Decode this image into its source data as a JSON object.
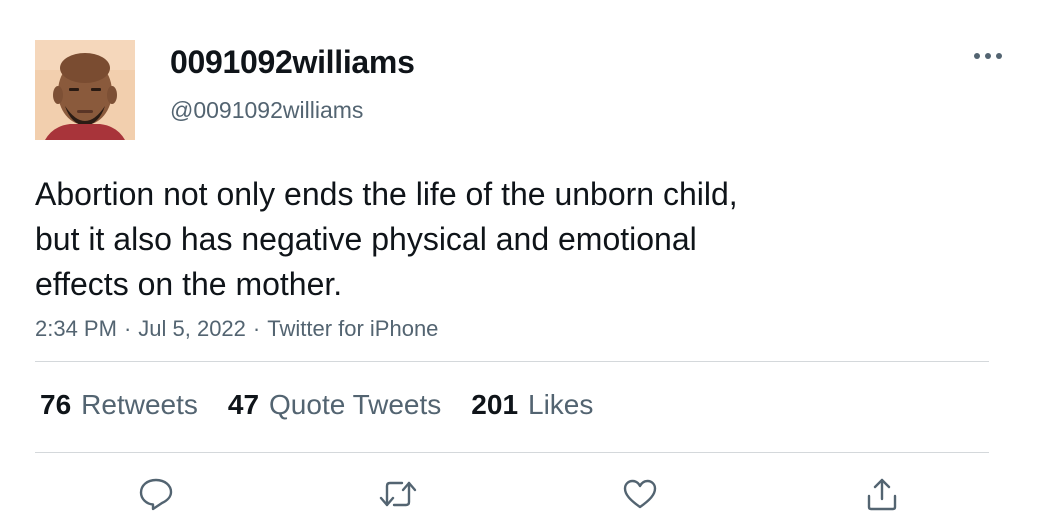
{
  "tweet": {
    "author": {
      "display_name": "0091092williams",
      "handle": "@0091092williams"
    },
    "text_lines": [
      "Abortion not only ends the life of the unborn child,",
      "but it also has negative physical and emotional",
      "effects on the mother."
    ],
    "time": "2:34 PM",
    "date": "Jul 5, 2022",
    "source": "Twitter for iPhone",
    "separator": "·",
    "stats": {
      "retweets_count": "76",
      "retweets_label": "Retweets",
      "quotes_count": "47",
      "quotes_label": "Quote Tweets",
      "likes_count": "201",
      "likes_label": "Likes"
    }
  },
  "icons": {
    "more": "more-horizontal-icon",
    "reply": "reply-icon",
    "retweet": "retweet-icon",
    "like": "heart-icon",
    "share": "share-icon"
  },
  "colors": {
    "text": "#0f1419",
    "secondary": "#536471",
    "divider": "#d4d8db"
  }
}
